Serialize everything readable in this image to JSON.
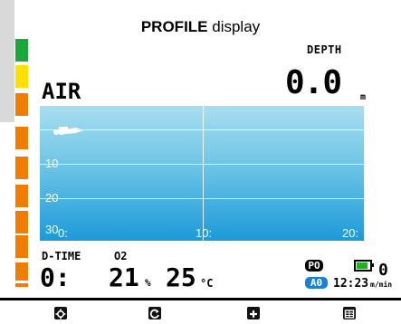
{
  "caption": {
    "bold": "PROFILE",
    "rest": " display"
  },
  "left_bar": {
    "colors": [
      "#1aa83a",
      "#ffe000",
      "#f07d00",
      "#f07d00",
      "#f07d00",
      "#f07d00",
      "#f07d00",
      "#f07d00",
      "#f07d00",
      "#f07d00",
      "#f07d00"
    ]
  },
  "depth": {
    "label": "DEPTH",
    "value": "0.0",
    "unit": "m"
  },
  "air": {
    "label": "AIR"
  },
  "profile_chart": {
    "y_ticks": [
      "10",
      "20",
      "30"
    ],
    "x_ticks": [
      "0:",
      "10:",
      "20:"
    ],
    "colors": {
      "top": "#a9def0",
      "bottom": "#1d9ad9",
      "grid": "#ffffff"
    }
  },
  "dive_time": {
    "label": "D-TIME",
    "value": "0:"
  },
  "o2": {
    "label": "O2",
    "value": "21",
    "unit": "%"
  },
  "temperature": {
    "value": "25",
    "unit": "°C"
  },
  "status": {
    "po_badge": "PO",
    "ao_badge": "A0",
    "time": "12:23",
    "ascent_rate": "0",
    "ascent_unit": "m/min",
    "battery_level": 0.85,
    "colors": {
      "po": "#000000",
      "ao": "#1a7fd6",
      "battery": "#1fb31f"
    }
  },
  "softkeys": [
    {
      "icon": "gear-icon"
    },
    {
      "icon": "cycle-icon"
    },
    {
      "icon": "plus-icon"
    },
    {
      "icon": "menu-icon"
    }
  ]
}
